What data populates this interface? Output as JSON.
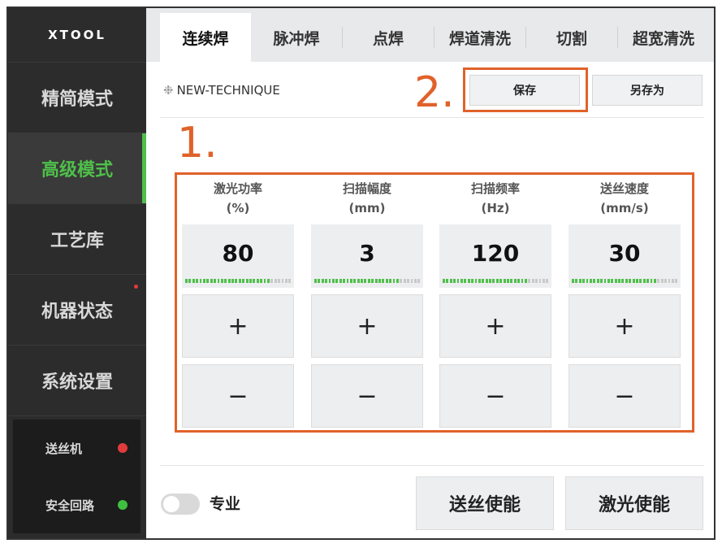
{
  "sidebar": {
    "logo": "XTOOL",
    "items": [
      {
        "label": "精简模式"
      },
      {
        "label": "高级模式"
      },
      {
        "label": "工艺库"
      },
      {
        "label": "机器状态"
      },
      {
        "label": "系统设置"
      }
    ],
    "status": [
      {
        "label": "送丝机",
        "color": "#e23b3b"
      },
      {
        "label": "安全回路",
        "color": "#3fbf3f"
      }
    ]
  },
  "tabs": [
    {
      "label": "连续焊"
    },
    {
      "label": "脉冲焊"
    },
    {
      "label": "点焊"
    },
    {
      "label": "焊道清洗"
    },
    {
      "label": "切割"
    },
    {
      "label": "超宽清洗"
    }
  ],
  "technique": {
    "name": "NEW-TECHNIQUE",
    "icon": "sparkle-icon"
  },
  "toolbar": {
    "save_label": "保存",
    "save_as_label": "另存为"
  },
  "annotations": {
    "label_1": "1.",
    "label_2": "2."
  },
  "params": [
    {
      "label": "激光功率",
      "unit": "(%)",
      "value": "80",
      "plus": "+",
      "minus": "−",
      "level": 0.8
    },
    {
      "label": "扫描幅度",
      "unit": "(mm)",
      "value": "3",
      "plus": "+",
      "minus": "−",
      "level": 0.8
    },
    {
      "label": "扫描频率",
      "unit": "(Hz)",
      "value": "120",
      "plus": "+",
      "minus": "−",
      "level": 0.8
    },
    {
      "label": "送丝速度",
      "unit": "(mm/s)",
      "value": "30",
      "plus": "+",
      "minus": "−",
      "level": 0.8
    }
  ],
  "footer": {
    "pro_label": "专业",
    "pro_toggle_on": false,
    "wire_enable_label": "送丝使能",
    "laser_enable_label": "激光使能"
  },
  "colors": {
    "accent": "#4fbf4a",
    "annotation": "#e0622a"
  }
}
